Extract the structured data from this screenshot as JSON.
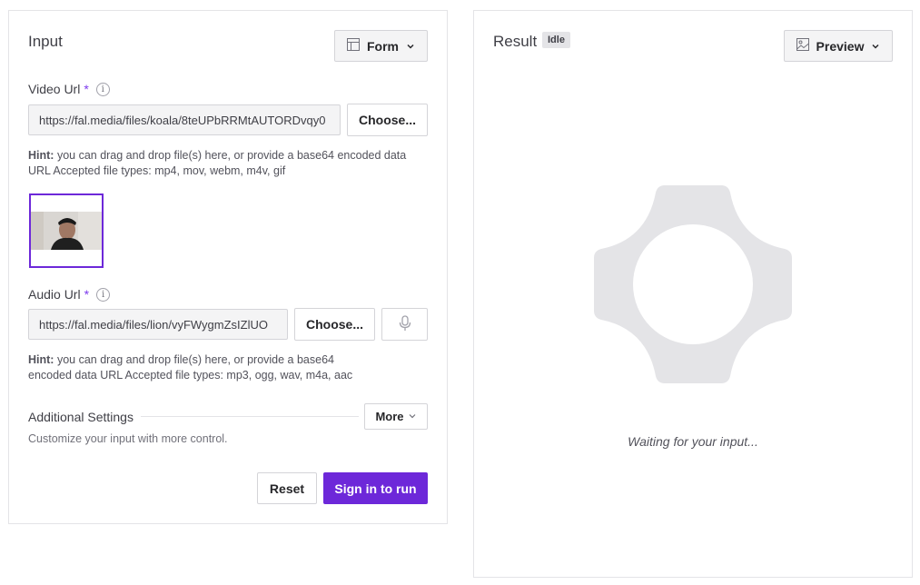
{
  "input": {
    "title": "Input",
    "form_button": "Form",
    "video": {
      "label": "Video Url",
      "required": "*",
      "value": "https://fal.media/files/koala/8teUPbRRMtAUTORDvqy0",
      "choose": "Choose...",
      "hint_bold": "Hint:",
      "hint_line1": " you can drag and drop file(s) here, or provide a base64 encoded data",
      "hint_line2": "URL Accepted file types: mp4, mov, webm, m4v, gif"
    },
    "audio": {
      "label": "Audio Url",
      "required": "*",
      "value": "https://fal.media/files/lion/vyFWygmZsIZlUO",
      "choose": "Choose...",
      "hint_bold": "Hint:",
      "hint_line1": " you can drag and drop file(s) here, or provide a base64",
      "hint_line2": "encoded data URL Accepted file types: mp3, ogg, wav, m4a, aac"
    },
    "additional": {
      "title": "Additional Settings",
      "more": "More",
      "description": "Customize your input with more control."
    },
    "reset": "Reset",
    "run": "Sign in to run"
  },
  "result": {
    "title": "Result",
    "status": "Idle",
    "preview_button": "Preview",
    "waiting": "Waiting for your input..."
  },
  "colors": {
    "accent": "#6d28d9",
    "placeholder_shape": "#e4e4e7"
  }
}
